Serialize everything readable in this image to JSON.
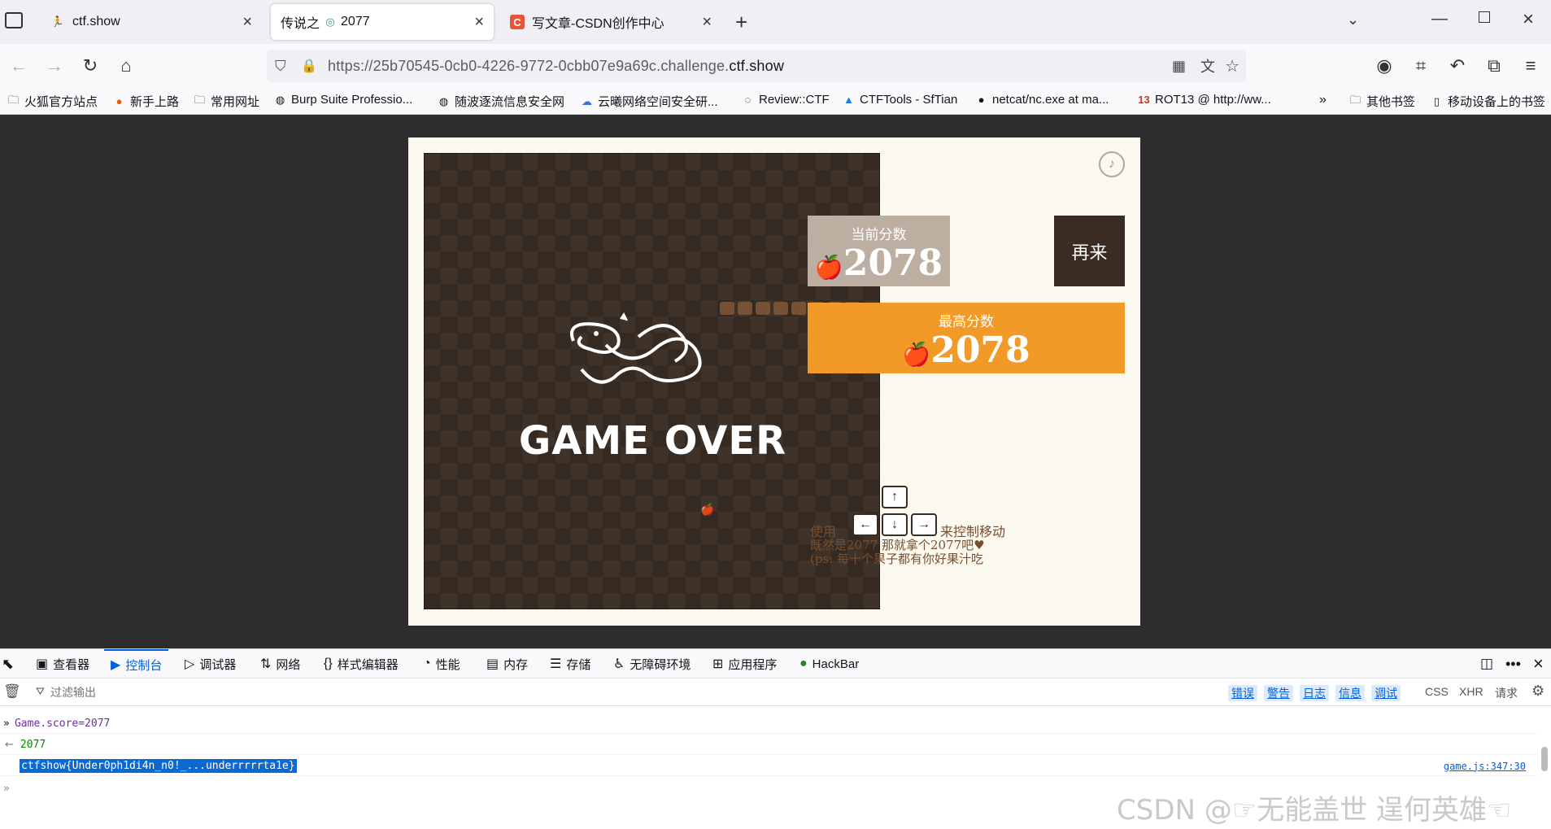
{
  "browser": {
    "tabs": [
      {
        "title": "ctf.show",
        "icon": "runner-icon"
      },
      {
        "title": "传说之",
        "title_suffix": "2077",
        "icon": "firefox-icon"
      },
      {
        "title": "写文章-CSDN创作中心",
        "icon": "csdn-icon"
      }
    ],
    "url_prefix": "https://25b70545-0cb0-4226-9772-0cbb07e9a69c.challenge.",
    "url_domain": "ctf.show",
    "bookmarks": [
      "火狐官方站点",
      "新手上路",
      "常用网址",
      "Burp Suite Professio...",
      "随波逐流信息安全网",
      "云曦网络空间安全研...",
      "Review::CTF",
      "CTFTools - SfTian",
      "netcat/nc.exe at ma...",
      "ROT13 @ http://ww..."
    ],
    "bookmarks_right": [
      "其他书签",
      "移动设备上的书签"
    ]
  },
  "game": {
    "current_label": "当前分数",
    "current_score": "2078",
    "best_label": "最高分数",
    "best_score": "2078",
    "again_label": "再来",
    "gameover": "GAME OVER",
    "hint_use": "使用",
    "hint_move": "来控制移动",
    "hint_line2": "既然是2077 那就拿个2077吧♥",
    "hint_line3": "(ps: 每十个果子都有你好果汁吃",
    "colors": {
      "board": "#3e3229",
      "best": "#f29a28",
      "current": "#bcaea0"
    }
  },
  "devtools": {
    "tabs": [
      "查看器",
      "控制台",
      "调试器",
      "网络",
      "样式编辑器",
      "性能",
      "内存",
      "存储",
      "无障碍环境",
      "应用程序",
      "HackBar"
    ],
    "filter_placeholder": "过滤输出",
    "levels": [
      "错误",
      "警告",
      "日志",
      "信息",
      "调试"
    ],
    "right_filters": [
      "CSS",
      "XHR",
      "请求"
    ],
    "console": {
      "input": "Game.score=2077",
      "result": "2077",
      "flag": "ctfshow{Under0ph1di4n_n0!_...underrrrrta1e}",
      "source": "game.js:347:30"
    }
  },
  "watermark": "CSDN @☞无能盖世 逞何英雄☜"
}
